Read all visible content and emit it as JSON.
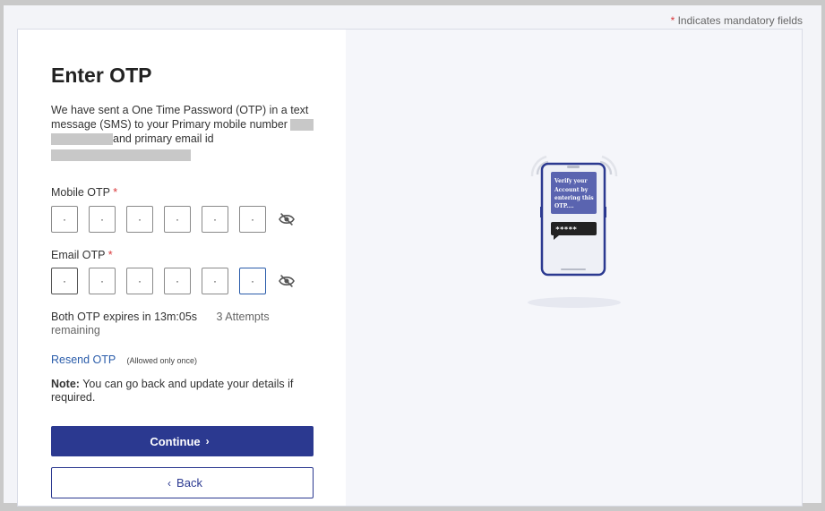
{
  "header": {
    "mandatory_star": "*",
    "mandatory_text": "Indicates mandatory fields"
  },
  "form": {
    "title": "Enter OTP",
    "description_part1": "We have sent a One Time Password (OTP) in a text message (SMS) to your Primary mobile number",
    "description_part2": "and primary email id",
    "mobile_label": "Mobile OTP",
    "email_label": "Email OTP",
    "required_star": "*",
    "mobile_otp": [
      "·",
      "·",
      "·",
      "·",
      "·",
      "·"
    ],
    "email_otp": [
      "·",
      "·",
      "·",
      "·",
      "·",
      "·"
    ],
    "expiry_text": "Both OTP expires in 13m:05s",
    "attempts_text": "3 Attempts",
    "remaining_text": "remaining",
    "resend_label": "Resend OTP",
    "resend_hint": "(Allowed only once)",
    "note_label": "Note:",
    "note_text": "You can go back and update your details if required.",
    "continue_label": "Continue",
    "back_label": "Back"
  },
  "illustration": {
    "message_text": "Verify your Account by entering this OTP....",
    "otp_mask": "*****"
  },
  "colors": {
    "primary": "#2b3990",
    "link": "#2a5caa",
    "required": "#d9373a"
  }
}
